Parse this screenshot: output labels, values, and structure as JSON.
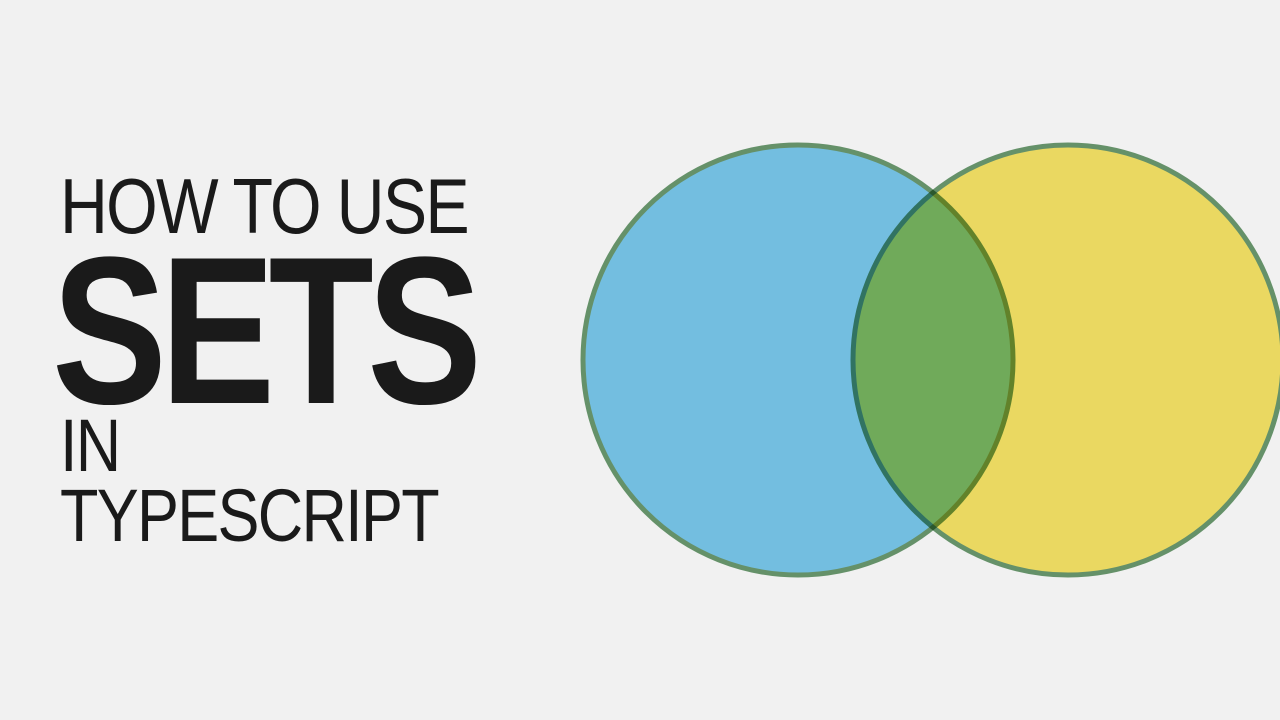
{
  "title": {
    "line1": "How to use",
    "line2": "Sets",
    "line3": "in Typescript"
  },
  "venn": {
    "left_circle": {
      "fill": "#6cc3eb",
      "stroke": "#6b9a6f",
      "opacity": 0.9
    },
    "right_circle": {
      "fill": "#f7e04b",
      "stroke": "#6b9a6f",
      "opacity": 0.85
    },
    "stroke_width": 5
  }
}
